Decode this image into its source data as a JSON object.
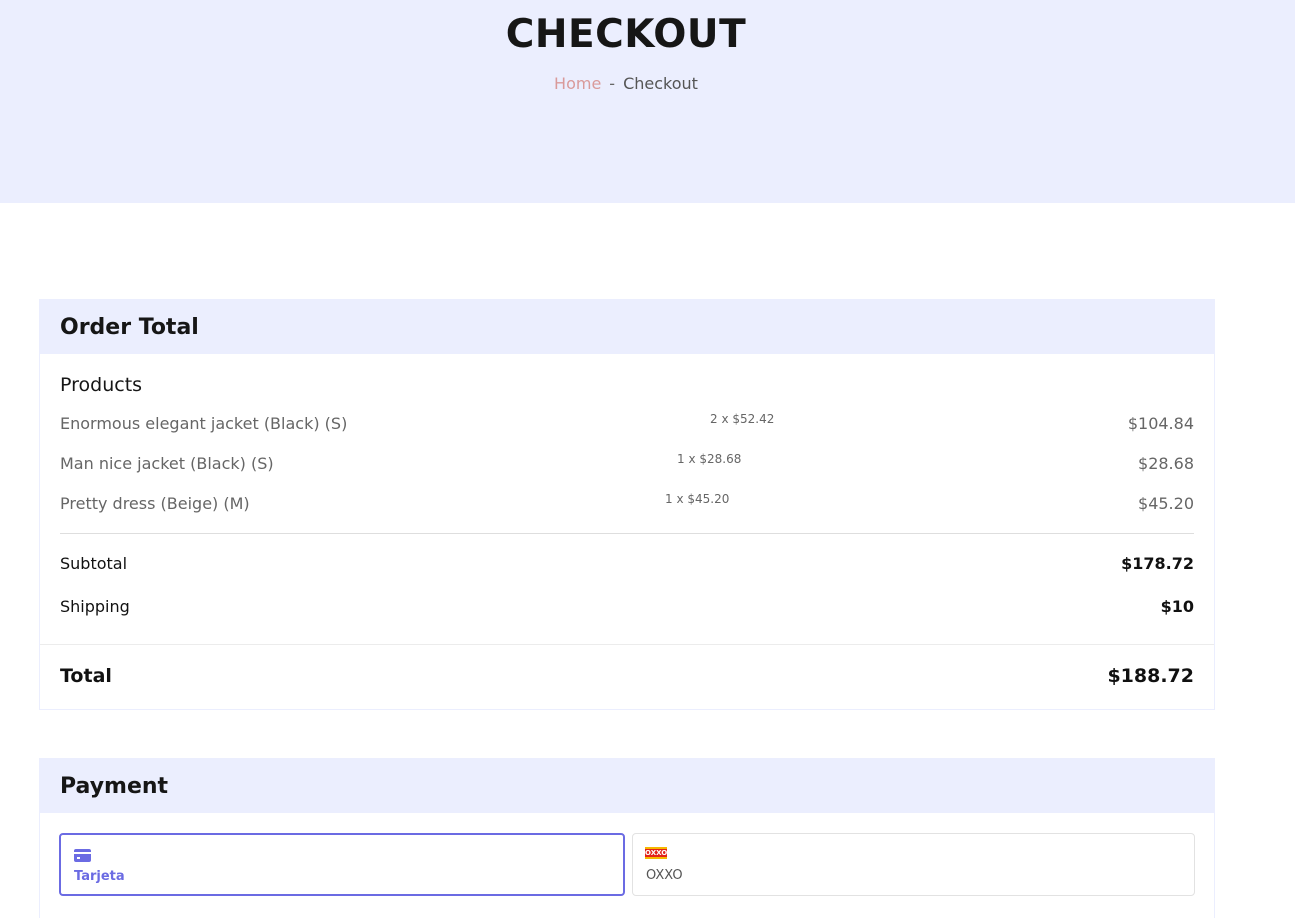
{
  "hero": {
    "title": "CHECKOUT",
    "breadcrumb": {
      "home": "Home",
      "separator": "-",
      "current": "Checkout"
    }
  },
  "order": {
    "title": "Order Total",
    "products_heading": "Products",
    "products": [
      {
        "name": "Enormous elegant jacket (Black) (S)",
        "qty": "2 x $52.42",
        "price": "$104.84"
      },
      {
        "name": "Man nice jacket (Black) (S)",
        "qty": "1 x $28.68",
        "price": "$28.68"
      },
      {
        "name": "Pretty dress (Beige) (M)",
        "qty": "1 x $45.20",
        "price": "$45.20"
      }
    ],
    "subtotal": {
      "label": "Subtotal",
      "value": "$178.72"
    },
    "shipping": {
      "label": "Shipping",
      "value": "$10"
    },
    "total": {
      "label": "Total",
      "value": "$188.72"
    }
  },
  "payment": {
    "title": "Payment",
    "options": [
      {
        "label": "Tarjeta",
        "icon": "credit-card-icon",
        "selected": true
      },
      {
        "label": "OXXO",
        "icon": "oxxo-logo-icon",
        "logo_text": "OXXO",
        "selected": false
      }
    ]
  },
  "colors": {
    "hero_bg": "#ebeefe",
    "accent": "#6b6be3",
    "breadcrumb_home": "#d99a9a"
  }
}
